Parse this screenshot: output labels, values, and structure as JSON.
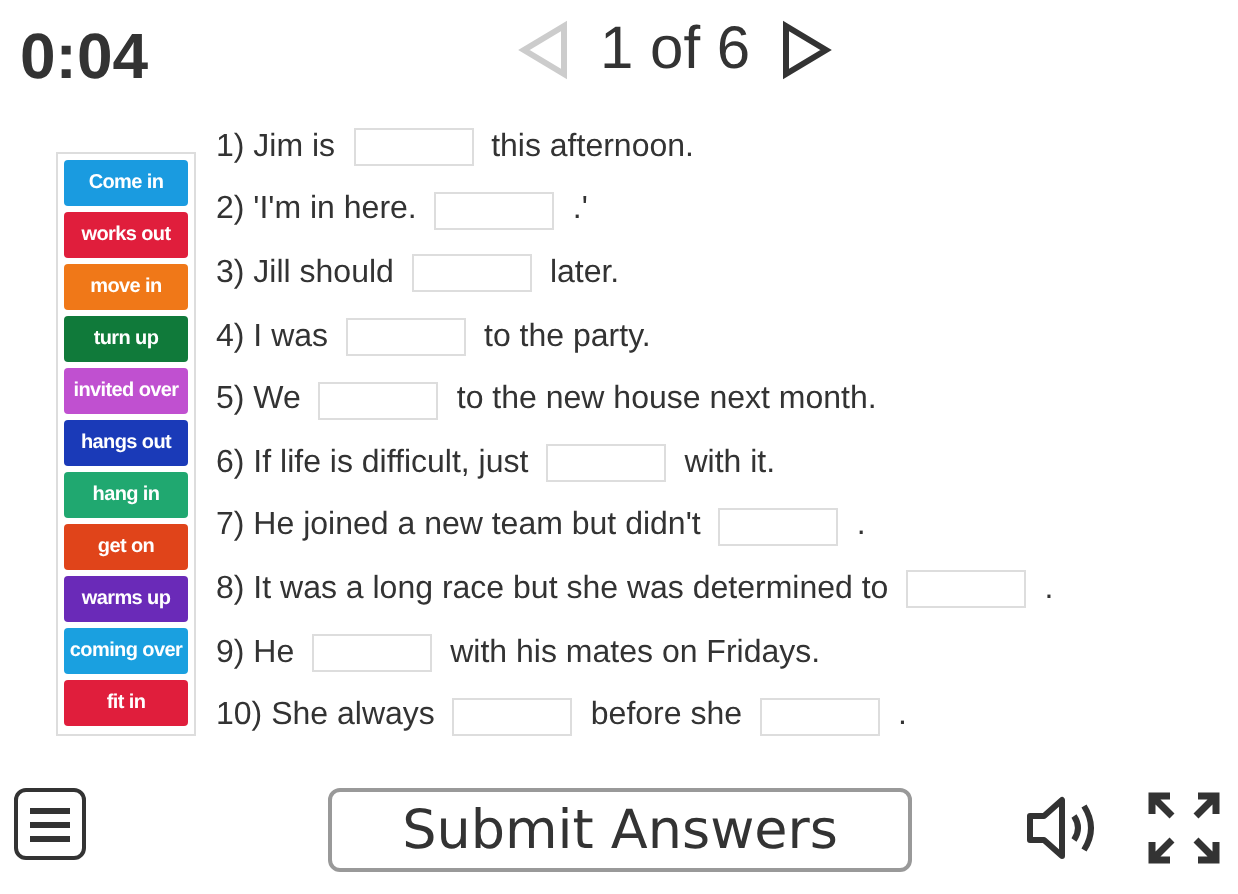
{
  "timer": "0:04",
  "pager": {
    "counter": "1 of 6",
    "prev": {
      "disabled": true
    },
    "next": {
      "disabled": false
    }
  },
  "word_bank": [
    {
      "text": "Come in",
      "color": "#1a9be0"
    },
    {
      "text": "works out",
      "color": "#e01e3c"
    },
    {
      "text": "move in",
      "color": "#f07818"
    },
    {
      "text": "turn up",
      "color": "#107a3a"
    },
    {
      "text": "invited over",
      "color": "#c050d0"
    },
    {
      "text": "hangs out",
      "color": "#1a3ab8"
    },
    {
      "text": "hang in",
      "color": "#20a870"
    },
    {
      "text": "get on",
      "color": "#e0441a"
    },
    {
      "text": "warms up",
      "color": "#6a2ab8"
    },
    {
      "text": "coming over",
      "color": "#1aa0e0"
    },
    {
      "text": "fit in",
      "color": "#e01e3c"
    }
  ],
  "sentences": [
    [
      {
        "kind": "text",
        "text": "1) Jim is"
      },
      {
        "kind": "blank"
      },
      {
        "kind": "text",
        "text": "this afternoon."
      }
    ],
    [
      {
        "kind": "text",
        "text": "2) 'I'm in here."
      },
      {
        "kind": "blank"
      },
      {
        "kind": "text",
        "text": ".'"
      }
    ],
    [
      {
        "kind": "text",
        "text": "3) Jill should"
      },
      {
        "kind": "blank"
      },
      {
        "kind": "text",
        "text": "later."
      }
    ],
    [
      {
        "kind": "text",
        "text": "4) I was"
      },
      {
        "kind": "blank"
      },
      {
        "kind": "text",
        "text": "to the party."
      }
    ],
    [
      {
        "kind": "text",
        "text": "5) We"
      },
      {
        "kind": "blank"
      },
      {
        "kind": "text",
        "text": "to the new house next month."
      }
    ],
    [
      {
        "kind": "text",
        "text": "6) If life is difficult, just"
      },
      {
        "kind": "blank"
      },
      {
        "kind": "text",
        "text": "with it."
      }
    ],
    [
      {
        "kind": "text",
        "text": "7) He joined a new team but didn't"
      },
      {
        "kind": "blank"
      },
      {
        "kind": "text",
        "text": "."
      }
    ],
    [
      {
        "kind": "text",
        "text": "8) It was a long race but she was determined to"
      },
      {
        "kind": "blank"
      },
      {
        "kind": "text",
        "text": "."
      }
    ],
    [
      {
        "kind": "text",
        "text": "9) He"
      },
      {
        "kind": "blank"
      },
      {
        "kind": "text",
        "text": "with his mates on Fridays."
      }
    ],
    [
      {
        "kind": "text",
        "text": "10) She always"
      },
      {
        "kind": "blank"
      },
      {
        "kind": "text",
        "text": "before she"
      },
      {
        "kind": "blank"
      },
      {
        "kind": "text",
        "text": "."
      }
    ]
  ],
  "submit_button": "Submit Answers"
}
